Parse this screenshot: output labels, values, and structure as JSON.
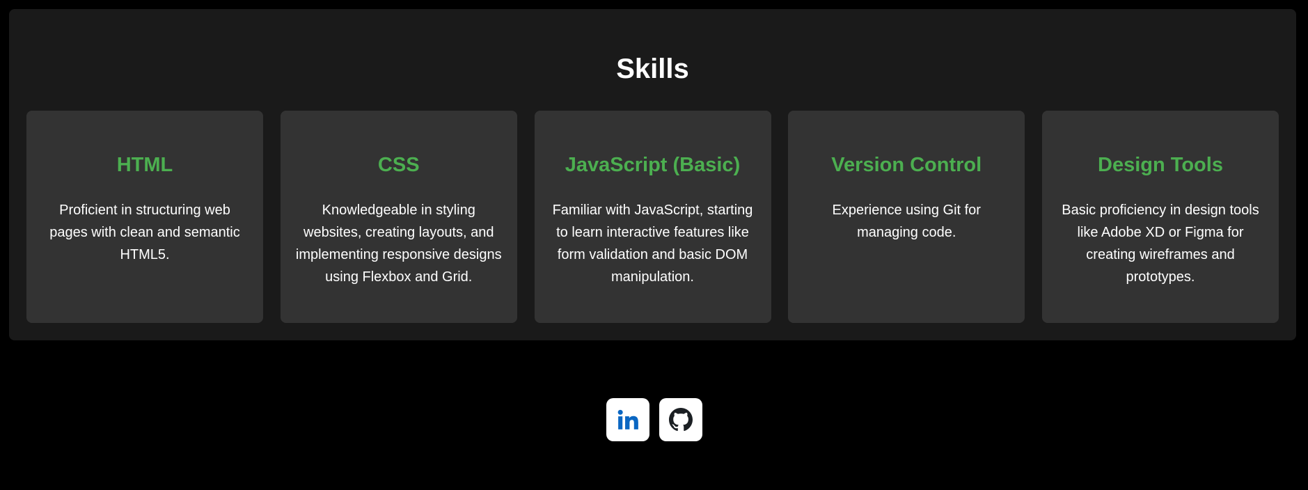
{
  "skills": {
    "title": "Skills",
    "items": [
      {
        "name": "HTML",
        "description": "Proficient in structuring web pages with clean and semantic HTML5."
      },
      {
        "name": "CSS",
        "description": "Knowledgeable in styling websites, creating layouts, and implementing responsive designs using Flexbox and Grid."
      },
      {
        "name": "JavaScript (Basic)",
        "description": "Familiar with JavaScript, starting to learn interactive features like form validation and basic DOM manipulation."
      },
      {
        "name": "Version Control",
        "description": "Experience using Git for managing code."
      },
      {
        "name": "Design Tools",
        "description": "Basic proficiency in design tools like Adobe XD or Figma for creating wireframes and prototypes."
      }
    ]
  },
  "social": {
    "links": [
      {
        "icon": "linkedin-icon",
        "color": "#0a66c2"
      },
      {
        "icon": "github-icon",
        "color": "#1b1f23"
      }
    ]
  },
  "colors": {
    "page_background": "#000000",
    "section_background": "#1a1a1a",
    "card_background": "#333333",
    "accent": "#4caf50",
    "text": "#ffffff"
  }
}
